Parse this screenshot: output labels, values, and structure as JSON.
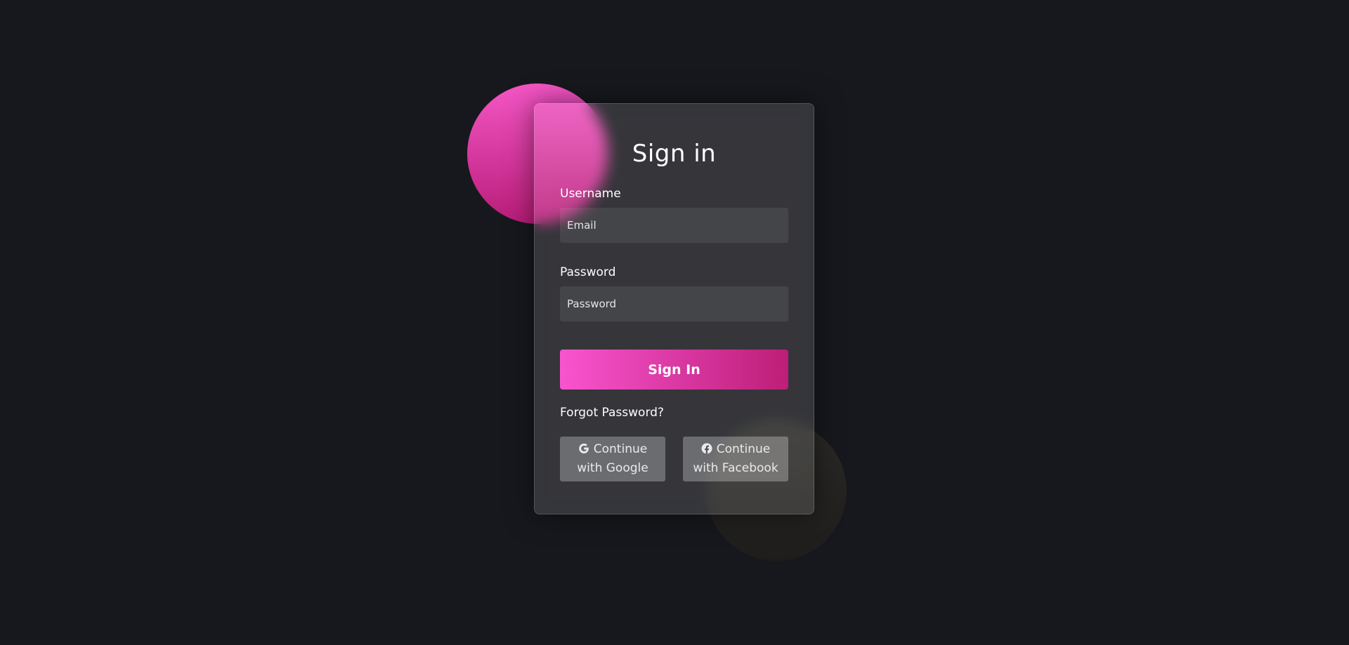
{
  "form": {
    "title": "Sign in",
    "username_label": "Username",
    "username_placeholder": "Email",
    "password_label": "Password",
    "password_placeholder": "Password",
    "submit_label": "Sign In",
    "forgot_label": "Forgot Password?"
  },
  "social": {
    "google": {
      "line1": "Continue",
      "line2": "with Google",
      "icon": "google-icon"
    },
    "facebook": {
      "line1": "Continue",
      "line2": "with Facebook",
      "icon": "facebook-icon"
    }
  },
  "colors": {
    "background": "#17181d",
    "accent_start": "#f954d0",
    "accent_end": "#bd1e77"
  }
}
